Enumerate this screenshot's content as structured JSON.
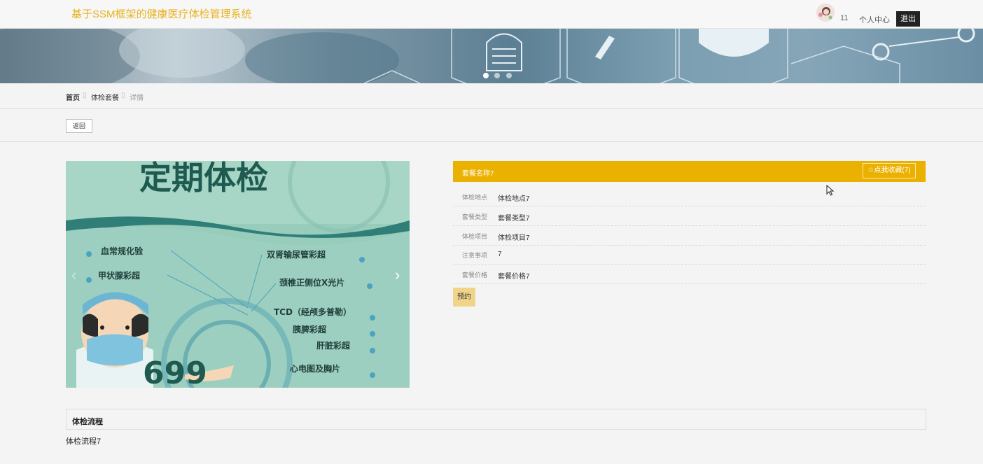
{
  "header": {
    "title": "基于SSM框架的健康医疗体检管理系统",
    "username": "11",
    "user_center": "个人中心",
    "logout": "退出"
  },
  "breadcrumb": {
    "home": "首页",
    "separator": "▯",
    "package": "体检套餐",
    "detail": "详情"
  },
  "back_button": "返回",
  "carousel": {
    "title_text": "定期体检",
    "items_left": [
      "血常规化验",
      "甲状腺彩超"
    ],
    "items_right": [
      "双肾输尿管彩超",
      "颈椎正侧位X光片",
      "TCD（经颅多普勒）",
      "胰脾彩超",
      "肝脏彩超",
      "心电图及胸片"
    ],
    "price_text": "699",
    "prev": "‹",
    "next": "›"
  },
  "package": {
    "name": "套餐名称7",
    "favorite_label": "☆点我收藏(7)",
    "fields": [
      {
        "label": "体检地点",
        "value": "体检地点7"
      },
      {
        "label": "套餐类型",
        "value": "套餐类型7"
      },
      {
        "label": "体检项目",
        "value": "体检项目7"
      },
      {
        "label": "注意事项",
        "value": "7"
      },
      {
        "label": "套餐价格",
        "value": "套餐价格7"
      }
    ],
    "book_label": "预约"
  },
  "process": {
    "title": "体检流程",
    "content": "体检流程7"
  },
  "colors": {
    "accent": "#ebb100",
    "title": "#e8b220",
    "book_button": "#f0d48a",
    "logout_bg": "#222222"
  }
}
